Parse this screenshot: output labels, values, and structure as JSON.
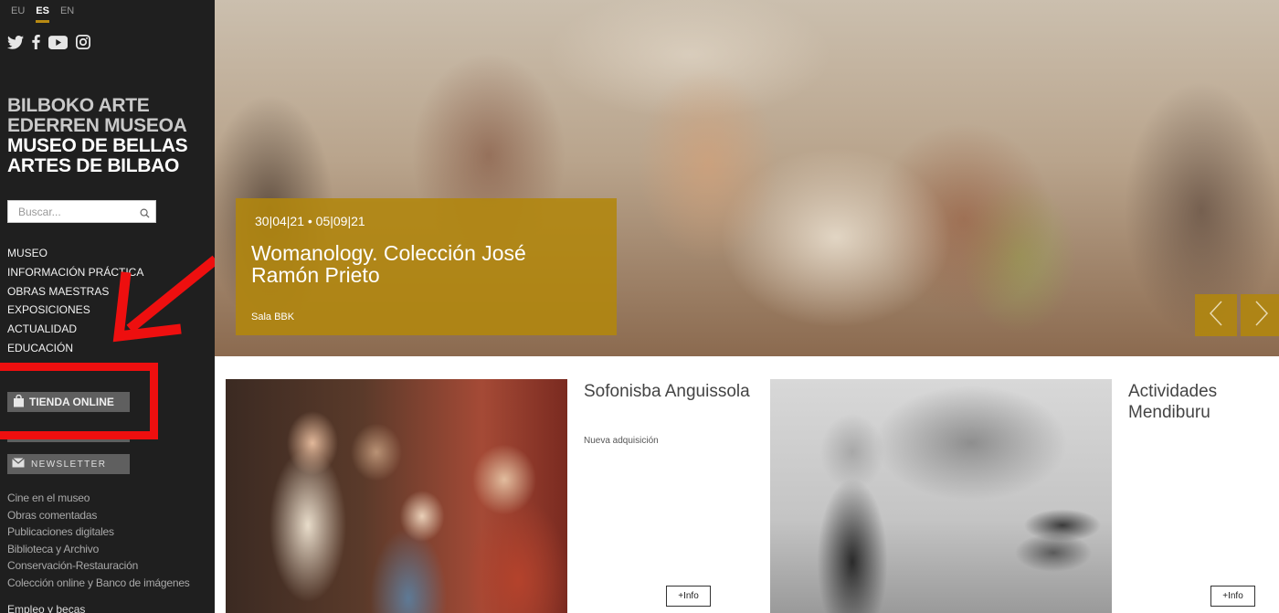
{
  "languages": [
    {
      "code": "EU",
      "active": false
    },
    {
      "code": "ES",
      "active": true
    },
    {
      "code": "EN",
      "active": false
    }
  ],
  "social_icons": [
    "twitter-icon",
    "facebook-icon",
    "youtube-icon",
    "instagram-icon"
  ],
  "brand": {
    "basque_line1": "BILBOKO ARTE",
    "basque_line2": "EDERREN MUSEOA",
    "spanish_line1": "MUSEO DE BELLAS",
    "spanish_line2": "ARTES DE BILBAO"
  },
  "search": {
    "placeholder": "Buscar..."
  },
  "main_nav": [
    "MUSEO",
    "INFORMACIÓN PRÁCTICA",
    "OBRAS MAESTRAS",
    "EXPOSICIONES",
    "ACTUALIDAD",
    "EDUCACIÓN"
  ],
  "buttons": {
    "tienda": "TIENDA ONLINE",
    "newsletter": "NEWSLETTER"
  },
  "sub_links": [
    "Cine en el museo",
    "Obras comentadas",
    "Publicaciones digitales",
    "Biblioteca y Archivo",
    "Conservación-Restauración",
    "Colección online y Banco de imágenes"
  ],
  "cut_link": "Empleo y becas",
  "hero": {
    "dates": "30|04|21 • 05|09|21",
    "title": "Womanology. Colección José Ramón Prieto",
    "venue": "Sala BBK"
  },
  "cards": [
    {
      "title": "Sofonisba Anguissola",
      "subtitle": "Nueva adquisición",
      "info": "+Info"
    },
    {
      "title": "Actividades Mendiburu",
      "subtitle": "",
      "info": "+Info"
    }
  ],
  "colors": {
    "accent_gold": "#b2860c",
    "annotation_red": "#ee0f0f",
    "sidebar_bg": "#1f1f1f"
  }
}
